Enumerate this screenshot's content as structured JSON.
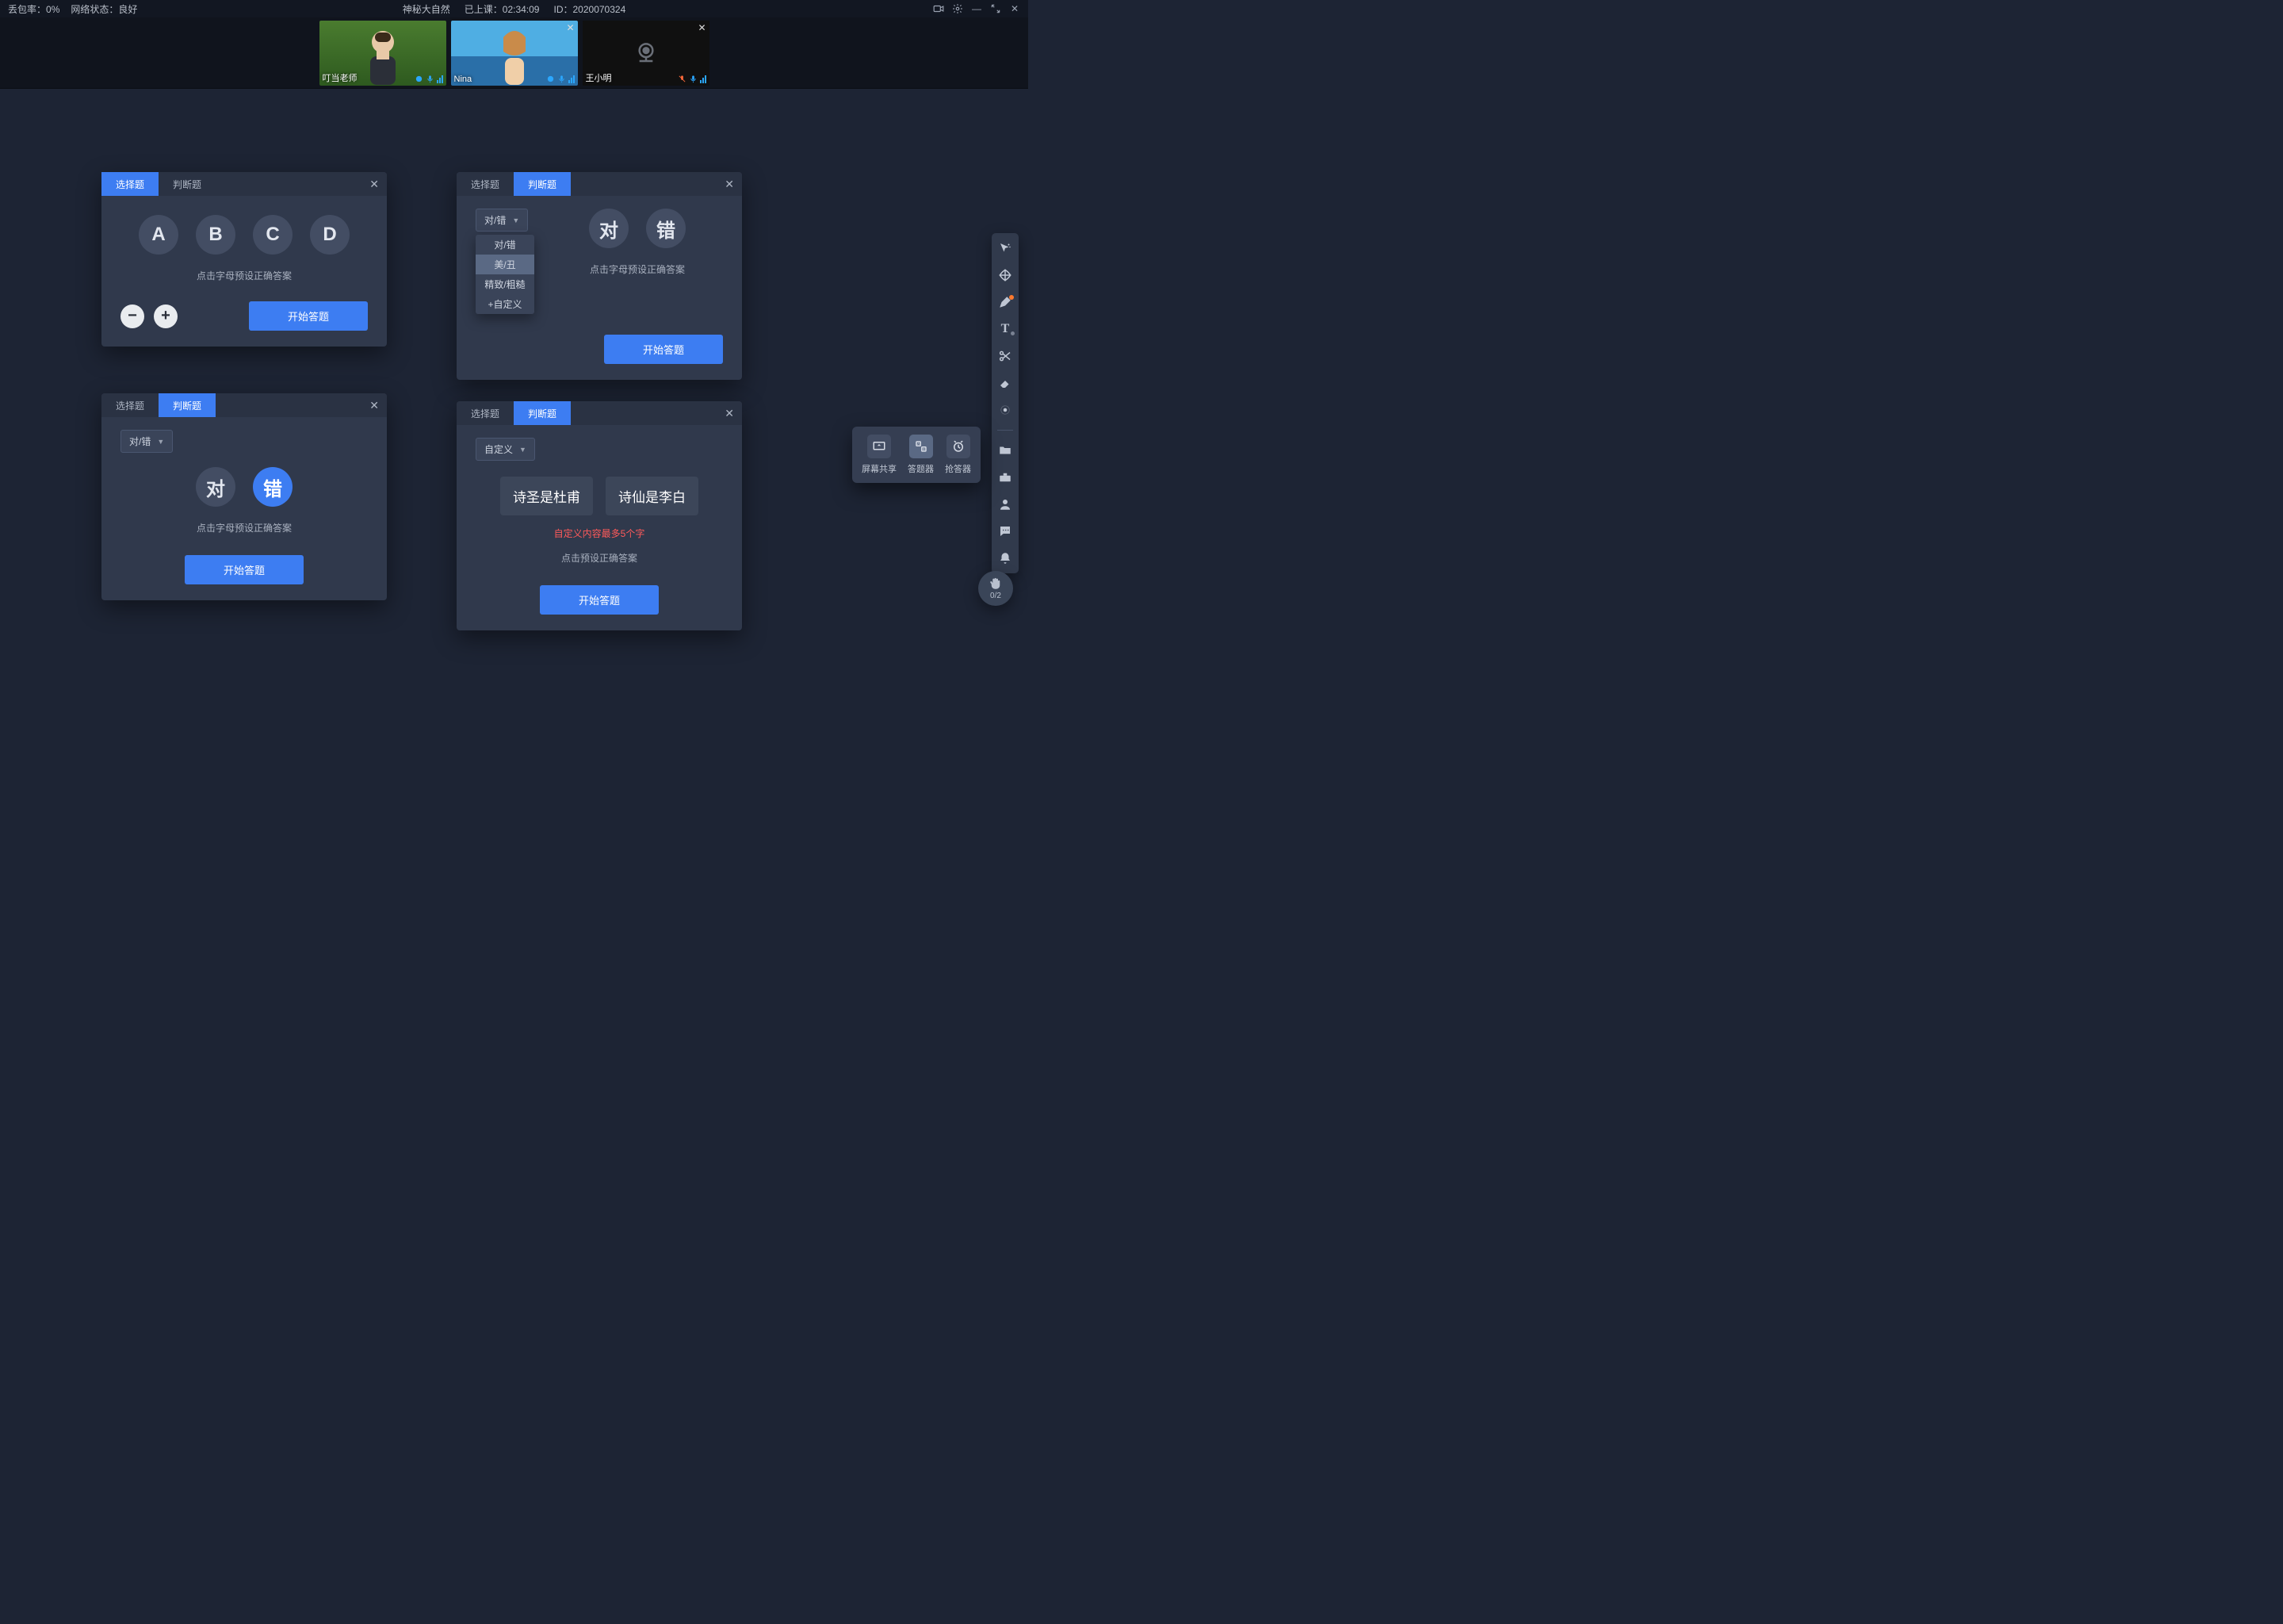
{
  "status": {
    "packet_loss_label": "丢包率：",
    "packet_loss_value": "0%",
    "net_label": "网络状态：",
    "net_value": "良好",
    "title": "神秘大自然",
    "elapsed_label": "已上课：",
    "elapsed_value": "02:34:09",
    "id_label": "ID：",
    "id_value": "2020070324"
  },
  "videos": [
    {
      "name": "叮当老师",
      "scene": "teacher",
      "has_close": false,
      "mic_on": true
    },
    {
      "name": "Nina",
      "scene": "nina",
      "has_close": true,
      "mic_on": true
    },
    {
      "name": "王小明",
      "scene": "off",
      "has_close": true,
      "mic_on": false
    }
  ],
  "panels": {
    "p1": {
      "tab_choice": "选择题",
      "tab_judge": "判断题",
      "options": [
        "A",
        "B",
        "C",
        "D"
      ],
      "hint": "点击字母预设正确答案",
      "start": "开始答题"
    },
    "p2": {
      "tab_choice": "选择题",
      "tab_judge": "判断题",
      "select_value": "对/错",
      "menu": [
        "对/错",
        "美/丑",
        "精致/粗糙",
        "+自定义"
      ],
      "option_a": "对",
      "option_b": "错",
      "hint": "点击字母预设正确答案",
      "start": "开始答题"
    },
    "p3": {
      "tab_choice": "选择题",
      "tab_judge": "判断题",
      "select_value": "对/错",
      "option_a": "对",
      "option_b": "错",
      "hint": "点击字母预设正确答案",
      "start": "开始答题"
    },
    "p4": {
      "tab_choice": "选择题",
      "tab_judge": "判断题",
      "select_value": "自定义",
      "custom_a": "诗圣是杜甫",
      "custom_b": "诗仙是李白",
      "warn": "自定义内容最多5个字",
      "hint": "点击预设正确答案",
      "start": "开始答题"
    }
  },
  "teach_tools": {
    "share": "屏幕共享",
    "answer": "答题器",
    "buzzer": "抢答器"
  },
  "hand_fab": {
    "count": "0/2"
  }
}
